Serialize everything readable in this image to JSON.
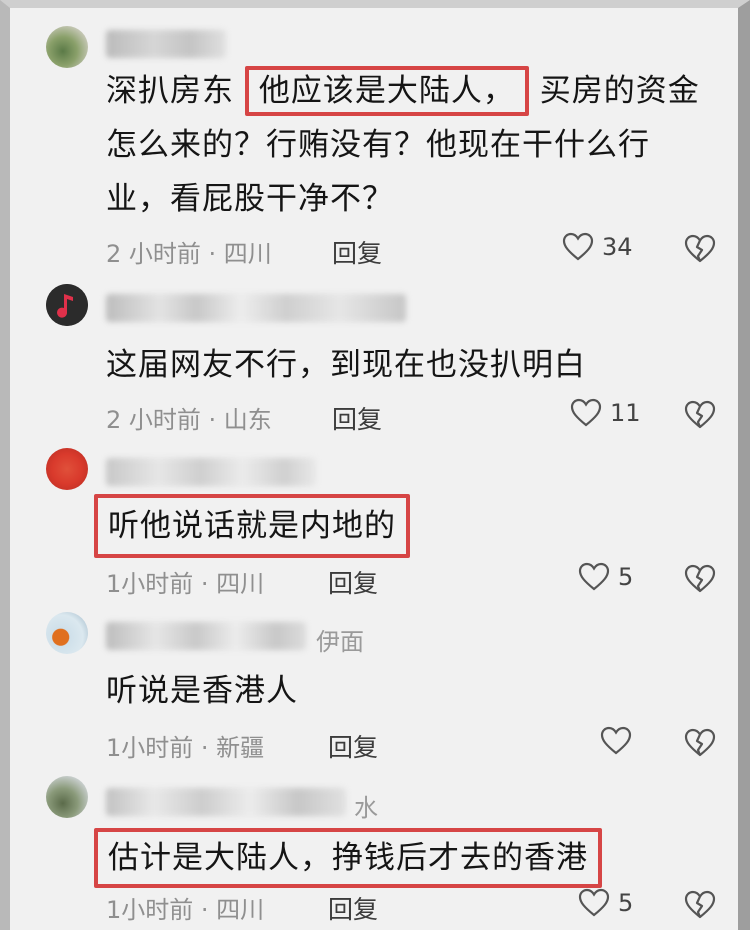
{
  "comments": [
    {
      "lines": [
        "深扒房东",
        "他应该是大陆人，",
        "买房的资金",
        "怎么来的？行贿没有？他现在干什么行",
        "业，看屁股干净不？"
      ],
      "meta": "2 小时前 · 四川",
      "reply": "回复",
      "likes": "34"
    },
    {
      "content": "这届网友不行，到现在也没扒明白",
      "meta": "2 小时前 · 山东",
      "reply": "回复",
      "likes": "11"
    },
    {
      "content": "听他说话就是内地的",
      "meta": "1小时前 · 四川",
      "reply": "回复",
      "likes": "5"
    },
    {
      "username_tail": "伊面",
      "content": "听说是香港人",
      "meta": "1小时前 · 新疆",
      "reply": "回复",
      "likes": ""
    },
    {
      "username_tail": "水",
      "content": "估计是大陆人，挣钱后才去的香港",
      "meta": "1小时前 · 四川",
      "reply": "回复",
      "likes": "5"
    }
  ]
}
